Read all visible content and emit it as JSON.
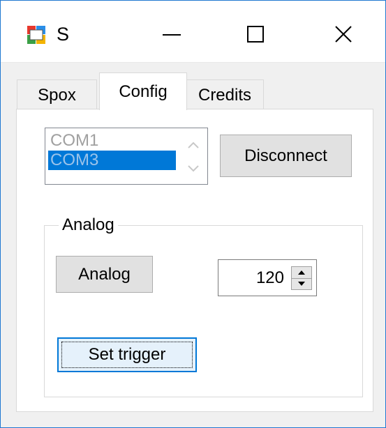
{
  "window": {
    "title": "S",
    "icon": "app-icon"
  },
  "tabs": [
    {
      "label": "Spox",
      "active": false
    },
    {
      "label": "Config",
      "active": true
    },
    {
      "label": "Credits",
      "active": false
    }
  ],
  "port_list": {
    "items": [
      "COM1",
      "COM3"
    ],
    "selected": "COM3"
  },
  "buttons": {
    "disconnect": "Disconnect",
    "analog": "Analog",
    "set_trigger": "Set trigger"
  },
  "analog_group": {
    "label": "Analog",
    "numeric_value": "120"
  },
  "colors": {
    "accent": "#0078d7",
    "border": "#1f78d1"
  }
}
